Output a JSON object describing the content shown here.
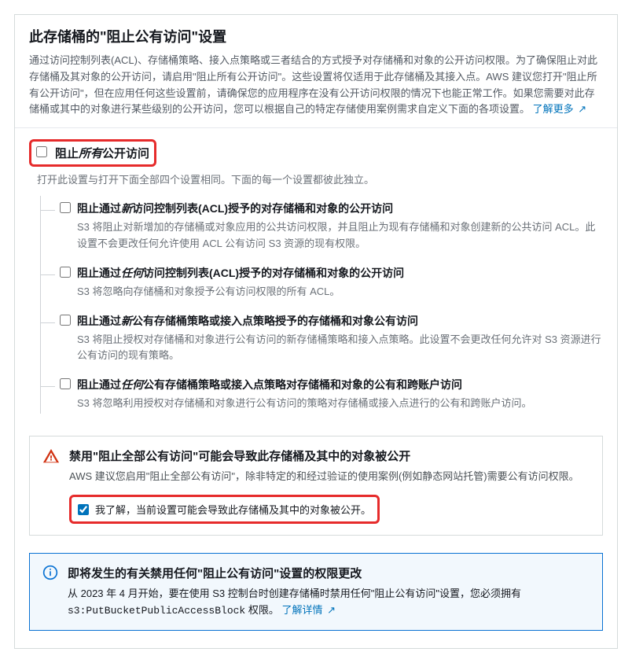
{
  "header": {
    "title": "此存储桶的\"阻止公有访问\"设置",
    "intro": "通过访问控制列表(ACL)、存储桶策略、接入点策略或三者结合的方式授予对存储桶和对象的公开访问权限。为了确保阻止对此存储桶及其对象的公开访问，请启用\"阻止所有公开访问\"。这些设置将仅适用于此存储桶及其接入点。AWS 建议您打开\"阻止所有公开访问\"，但在应用任何这些设置前，请确保您的应用程序在没有公开访问权限的情况下也能正常工作。如果您需要对此存储桶或其中的对象进行某些级别的公开访问，您可以根据自己的特定存储使用案例需求自定义下面的各项设置。",
    "learn_more": "了解更多"
  },
  "block_all": {
    "label_pre": "阻止",
    "label_em": "所有",
    "label_post": "公开访问",
    "desc": "打开此设置与打开下面全部四个设置相同。下面的每一个设置都彼此独立。"
  },
  "options": [
    {
      "title_pre": "阻止通过",
      "title_em": "新",
      "title_post": "访问控制列表(ACL)授予的对存储桶和对象的公开访问",
      "desc": "S3 将阻止对新增加的存储桶或对象应用的公共访问权限，并且阻止为现有存储桶和对象创建新的公共访问 ACL。此设置不会更改任何允许使用 ACL 公有访问 S3 资源的现有权限。"
    },
    {
      "title_pre": "阻止通过",
      "title_em": "任何",
      "title_post": "访问控制列表(ACL)授予的对存储桶和对象的公开访问",
      "desc": "S3 将忽略向存储桶和对象授予公有访问权限的所有 ACL。"
    },
    {
      "title_pre": "阻止通过",
      "title_em": "新",
      "title_post": "公有存储桶策略或接入点策略授予的存储桶和对象公有访问",
      "desc": "S3 将阻止授权对存储桶和对象进行公有访问的新存储桶策略和接入点策略。此设置不会更改任何允许对 S3 资源进行公有访问的现有策略。"
    },
    {
      "title_pre": "阻止通过",
      "title_em": "任何",
      "title_post": "公有存储桶策略或接入点策略对存储桶和对象的公有和跨账户访问",
      "desc": "S3 将忽略利用授权对存储桶和对象进行公有访问的策略对存储桶或接入点进行的公有和跨账户访问。"
    }
  ],
  "warning": {
    "title": "禁用\"阻止全部公有访问\"可能会导致此存储桶及其中的对象被公开",
    "text": "AWS 建议您启用\"阻止全部公有访问\"，除非特定的和经过验证的使用案例(例如静态网站托管)需要公有访问权限。",
    "ack": "我了解，当前设置可能会导致此存储桶及其中的对象被公开。"
  },
  "info": {
    "title": "即将发生的有关禁用任何\"阻止公有访问\"设置的权限更改",
    "text_pre": "从 2023 年 4 月开始，要在使用 S3 控制台时创建存储桶时禁用任何\"阻止公有访问\"设置，您必须拥有 ",
    "code": "s3:PutBucketPublicAccessBlock",
    "text_post": " 权限。",
    "learn": "了解详情"
  }
}
